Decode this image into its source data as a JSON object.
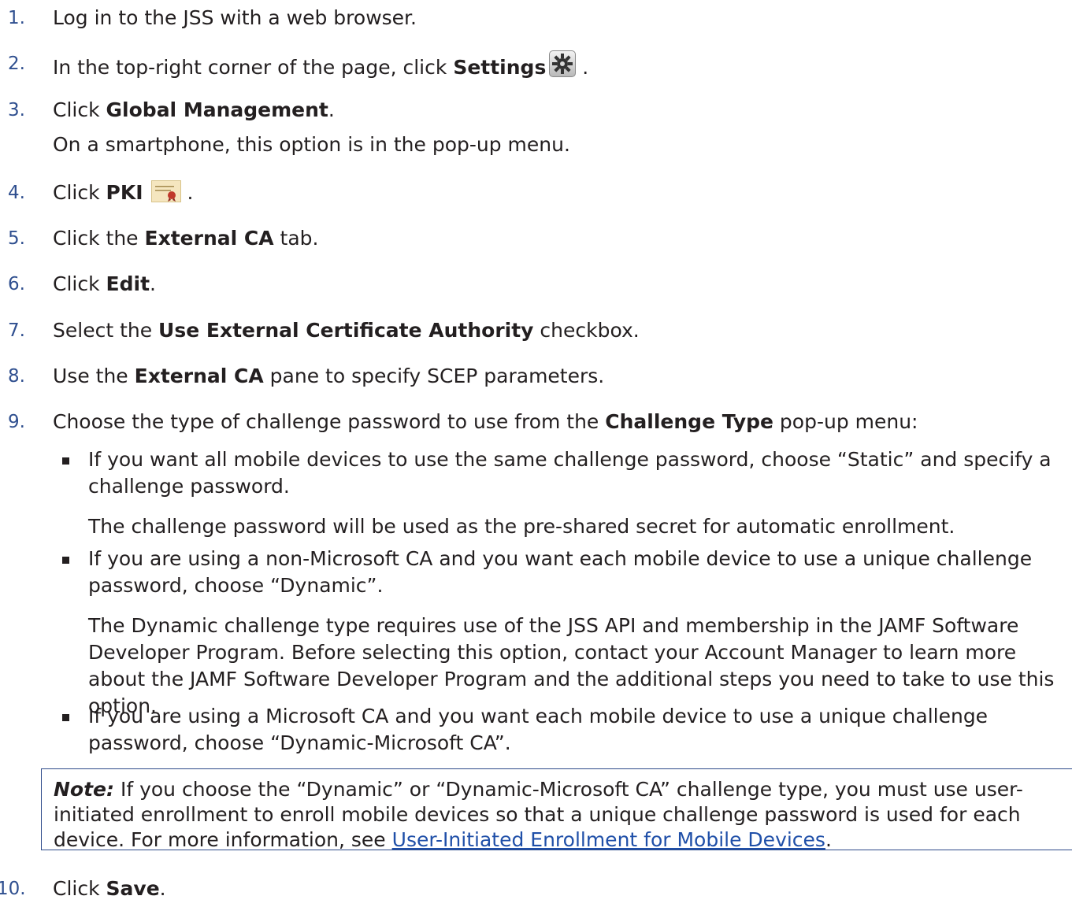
{
  "steps": [
    {
      "num": "1.",
      "text": "Log in to the JSS with a web browser."
    },
    {
      "num": "2.",
      "pre": "In the top-right corner of the page, click ",
      "bold": "Settings",
      "post": " ."
    },
    {
      "num": "3.",
      "pre": "Click ",
      "bold": "Global Management",
      "post": ".",
      "sub": "On a smartphone, this option is in the pop-up menu."
    },
    {
      "num": "4.",
      "pre": "Click ",
      "bold": "PKI",
      "post": " ."
    },
    {
      "num": "5.",
      "pre": "Click the ",
      "bold": "External CA",
      "post": " tab."
    },
    {
      "num": "6.",
      "pre": "Click ",
      "bold": "Edit",
      "post": "."
    },
    {
      "num": "7.",
      "pre": "Select the ",
      "bold": "Use External Certificate Authority",
      "post": " checkbox."
    },
    {
      "num": "8.",
      "pre": "Use the ",
      "bold": "External CA",
      "post": " pane to specify SCEP parameters."
    },
    {
      "num": "9.",
      "pre": "Choose the type of challenge password to use from the ",
      "bold": "Challenge Type",
      "post": " pop-up menu:"
    },
    {
      "num": "10.",
      "pre": "Click ",
      "bold": "Save",
      "post": "."
    }
  ],
  "bullets": [
    {
      "text": "If you want all mobile devices to use the same challenge password, choose “Static” and specify a challenge password.",
      "para": "The challenge password will be used as the pre-shared secret for automatic enrollment."
    },
    {
      "text": "If you are using a non-Microsoft CA and you want each mobile device to use a unique challenge password, choose “Dynamic”.",
      "para": "The Dynamic challenge type requires use of the JSS API and membership in the JAMF Software Developer Program. Before selecting this option, contact your Account Manager to learn more about the JAMF Software Developer Program and the additional steps you need to take to use this option."
    },
    {
      "text": "If you are using a Microsoft CA and you want each mobile device to use a unique challenge password, choose “Dynamic-Microsoft CA”."
    }
  ],
  "note": {
    "label": "Note:",
    "text": " If you choose the “Dynamic” or “Dynamic-Microsoft CA” challenge type, you must use user-initiated enrollment to enroll mobile devices so that a unique challenge password is used for each device. For more information, see ",
    "link": "User-Initiated Enrollment for Mobile Devices",
    "post": "."
  },
  "icons": {
    "settings": "gear-icon",
    "pki": "certificate-icon"
  },
  "colors": {
    "number": "#2f4f8f",
    "note_border": "#2e4a8a",
    "link": "#1f4fa8"
  }
}
